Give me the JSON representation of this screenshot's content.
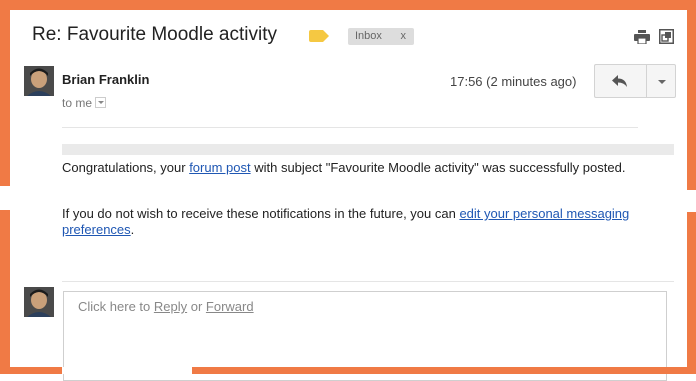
{
  "email": {
    "subject": "Re: Favourite Moodle activity",
    "label_chip": "Inbox",
    "label_chip_close": "x",
    "label_color": "#f5c842",
    "sender": "Brian Franklin",
    "to_me": "to me",
    "timestamp": "17:56 (2 minutes ago)",
    "body": {
      "p1_before": "Congratulations, your ",
      "p1_link": "forum post",
      "p1_after": " with subject \"Favourite Moodle activity\" was successfully posted.",
      "p2_before": "If you do not wish to receive these notifications in the future, you can ",
      "p2_link": "edit your personal messaging preferences",
      "p2_after": "."
    }
  },
  "reply": {
    "prompt_before": "Click here to ",
    "reply_link": "Reply",
    "prompt_or": " or ",
    "forward_link": "Forward"
  },
  "icons": {
    "label": "label-tag-icon",
    "print": "print-icon",
    "new_window": "new-window-icon",
    "reply": "reply-arrow-icon",
    "more": "chevron-down-icon",
    "avatar": "avatar"
  },
  "colors": {
    "frame": "#f07a45",
    "link": "#1f57b3"
  }
}
